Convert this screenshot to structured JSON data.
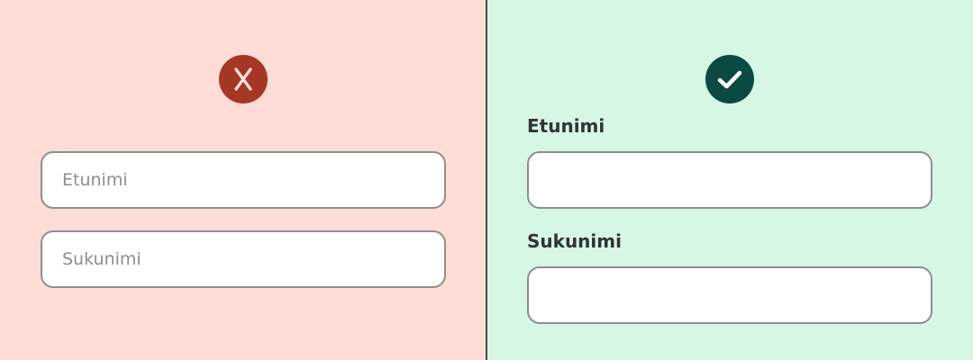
{
  "bad_example": {
    "icon": "x-icon",
    "color": "#a63726",
    "background": "#ffdcd6",
    "first_name_placeholder": "Etunimi",
    "last_name_placeholder": "Sukunimi"
  },
  "good_example": {
    "icon": "check-icon",
    "color": "#0b4a43",
    "background": "#d6f7e4",
    "first_name_label": "Etunimi",
    "last_name_label": "Sukunimi"
  }
}
